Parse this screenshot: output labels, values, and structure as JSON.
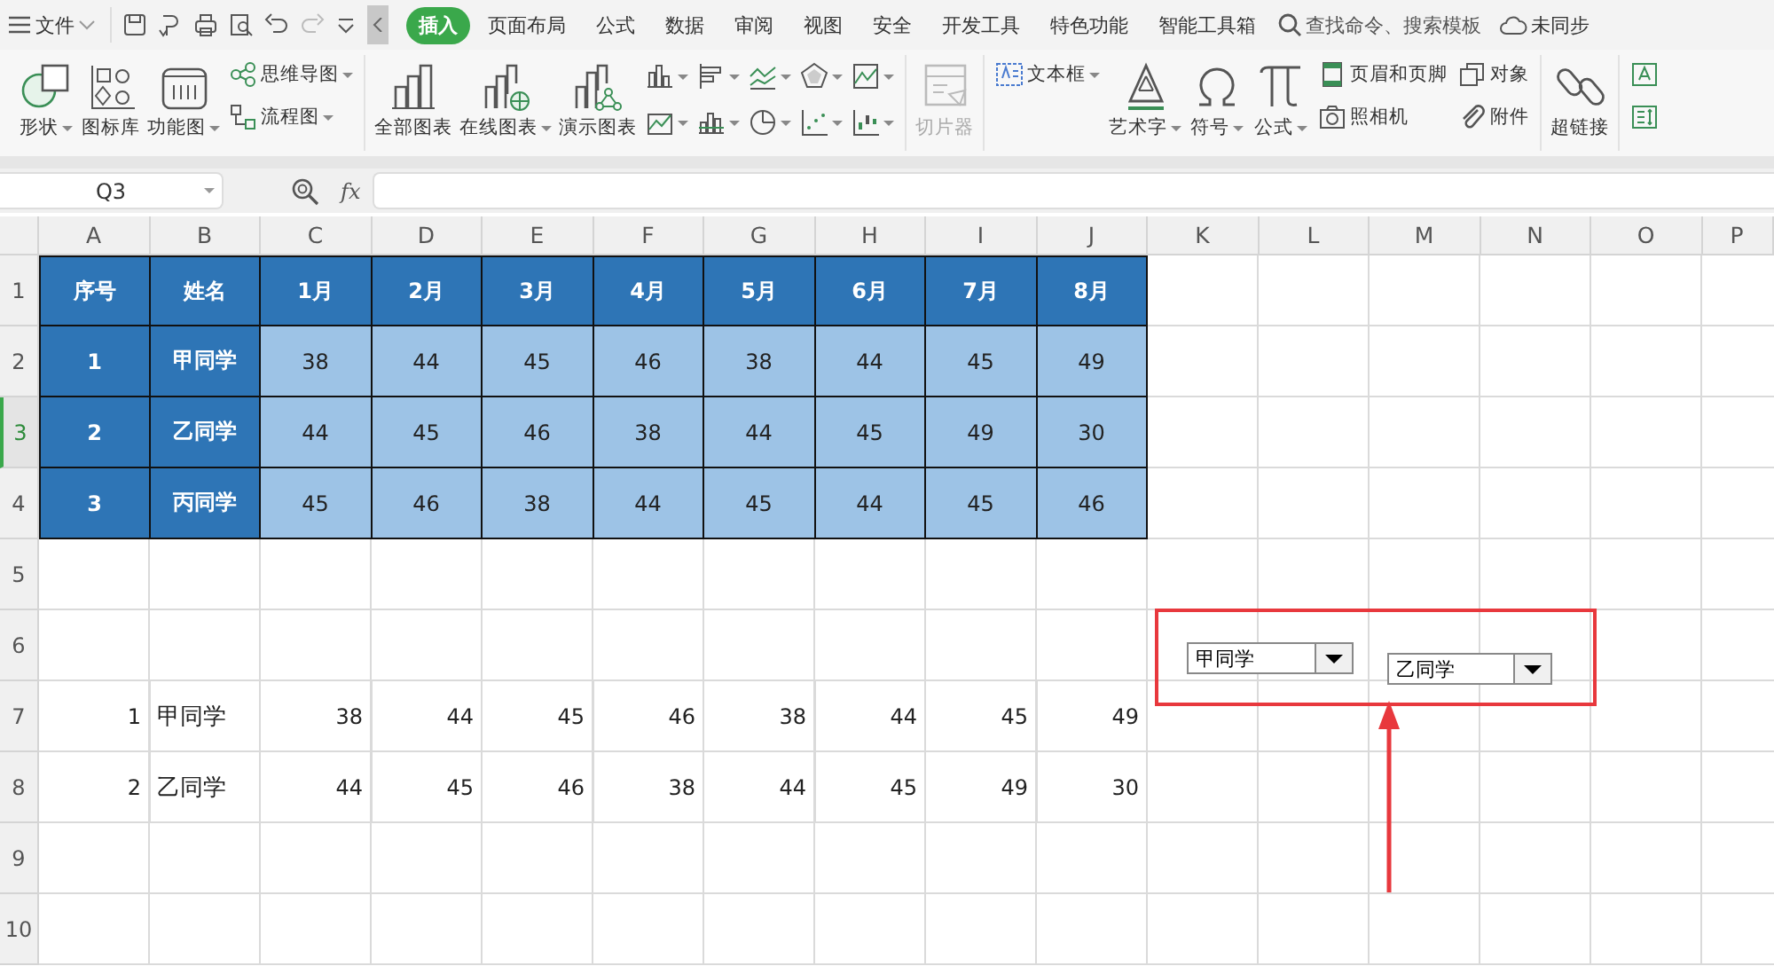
{
  "menu_bar": {
    "file_label": "文件",
    "tabs": [
      {
        "label": "插入",
        "selected": true
      },
      {
        "label": "页面布局",
        "selected": false
      },
      {
        "label": "公式",
        "selected": false
      },
      {
        "label": "数据",
        "selected": false
      },
      {
        "label": "审阅",
        "selected": false
      },
      {
        "label": "视图",
        "selected": false
      },
      {
        "label": "安全",
        "selected": false
      },
      {
        "label": "开发工具",
        "selected": false
      },
      {
        "label": "特色功能",
        "selected": false
      },
      {
        "label": "智能工具箱",
        "selected": false
      }
    ],
    "search_placeholder": "查找命令、搜索模板",
    "sync_label": "未同步"
  },
  "ribbon": {
    "groups": [
      {
        "kind": "large",
        "label": "形状",
        "dropdown": true,
        "disabled": false
      },
      {
        "kind": "large",
        "label": "图标库",
        "dropdown": false,
        "disabled": false
      },
      {
        "kind": "large",
        "label": "功能图",
        "dropdown": true,
        "disabled": false
      },
      {
        "kind": "stack",
        "items": [
          {
            "label": "思维导图",
            "dropdown": true
          },
          {
            "label": "流程图",
            "dropdown": true
          }
        ]
      },
      {
        "kind": "separator"
      },
      {
        "kind": "large",
        "label": "全部图表",
        "dropdown": false,
        "disabled": false
      },
      {
        "kind": "large",
        "label": "在线图表",
        "dropdown": true,
        "disabled": false
      },
      {
        "kind": "large",
        "label": "演示图表",
        "dropdown": false,
        "disabled": false
      },
      {
        "kind": "chart_icons"
      },
      {
        "kind": "separator"
      },
      {
        "kind": "large",
        "label": "切片器",
        "dropdown": false,
        "disabled": true
      },
      {
        "kind": "separator"
      },
      {
        "kind": "stack",
        "items": [
          {
            "label": "文本框",
            "dropdown": true
          }
        ]
      },
      {
        "kind": "large",
        "label": "艺术字",
        "dropdown": true,
        "disabled": false
      },
      {
        "kind": "large",
        "label": "符号",
        "dropdown": true,
        "disabled": false
      },
      {
        "kind": "large",
        "label": "公式",
        "dropdown": true,
        "disabled": false
      },
      {
        "kind": "stack",
        "items": [
          {
            "label": "页眉和页脚",
            "dropdown": false
          },
          {
            "label": "照相机",
            "dropdown": false
          }
        ]
      },
      {
        "kind": "stack",
        "items": [
          {
            "label": "对象",
            "dropdown": false
          },
          {
            "label": "附件",
            "dropdown": false
          }
        ]
      },
      {
        "kind": "separator"
      },
      {
        "kind": "large",
        "label": "超链接",
        "dropdown": false,
        "disabled": false
      },
      {
        "kind": "separator"
      },
      {
        "kind": "stack",
        "items": [
          {
            "dropdown": false
          },
          {
            "dropdown": false
          }
        ]
      }
    ]
  },
  "formula_bar": {
    "name_box": "Q3",
    "fx_label": "fx"
  },
  "sheet": {
    "columns": [
      "A",
      "B",
      "C",
      "D",
      "E",
      "F",
      "G",
      "H",
      "I",
      "J",
      "K",
      "L",
      "M",
      "N",
      "O",
      "P"
    ],
    "rows": [
      {
        "number": "1",
        "selected": false,
        "kind": "header",
        "cells": [
          "序号",
          "姓名",
          "1月",
          "2月",
          "3月",
          "4月",
          "5月",
          "6月",
          "7月",
          "8月"
        ]
      },
      {
        "number": "2",
        "selected": false,
        "kind": "body",
        "cells": [
          "1",
          "甲同学",
          "38",
          "44",
          "45",
          "46",
          "38",
          "44",
          "45",
          "49"
        ]
      },
      {
        "number": "3",
        "selected": true,
        "kind": "body",
        "cells": [
          "2",
          "乙同学",
          "44",
          "45",
          "46",
          "38",
          "44",
          "45",
          "49",
          "30"
        ]
      },
      {
        "number": "4",
        "selected": false,
        "kind": "body",
        "cells": [
          "3",
          "丙同学",
          "45",
          "46",
          "38",
          "44",
          "45",
          "44",
          "45",
          "46"
        ]
      },
      {
        "number": "5",
        "selected": false,
        "kind": "plain",
        "cells": []
      },
      {
        "number": "6",
        "selected": false,
        "kind": "plain",
        "cells": []
      },
      {
        "number": "7",
        "selected": false,
        "kind": "plain",
        "cells": [
          "1",
          "甲同学",
          "38",
          "44",
          "45",
          "46",
          "38",
          "44",
          "45",
          "49"
        ]
      },
      {
        "number": "8",
        "selected": false,
        "kind": "plain",
        "cells": [
          "2",
          "乙同学",
          "44",
          "45",
          "46",
          "38",
          "44",
          "45",
          "49",
          "30"
        ]
      },
      {
        "number": "9",
        "selected": false,
        "kind": "plain",
        "cells": []
      },
      {
        "number": "10",
        "selected": false,
        "kind": "plain",
        "cells": []
      }
    ],
    "dropdowns": [
      {
        "value": "甲同学"
      },
      {
        "value": "乙同学"
      }
    ]
  }
}
